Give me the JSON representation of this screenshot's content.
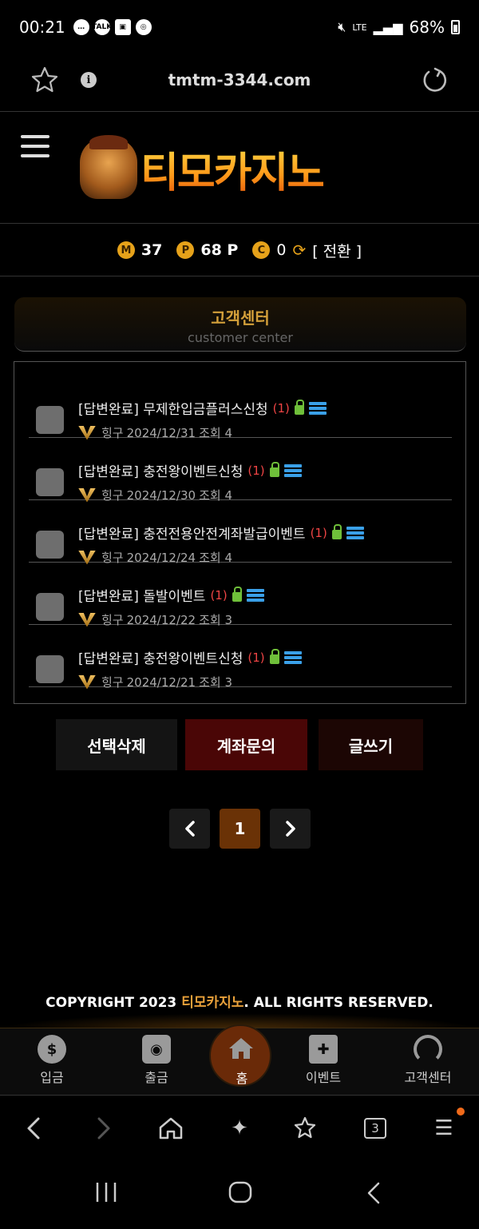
{
  "status_bar": {
    "time": "00:21",
    "battery": "68%",
    "network": "LTE"
  },
  "browser": {
    "url": "tmtm-3344.com"
  },
  "site": {
    "logo_text": "티모카지노"
  },
  "points": {
    "m_label": "M",
    "m_value": "37",
    "p_label": "P",
    "p_value": "68 P",
    "c_label": "C",
    "c_value": "0",
    "switch_label": "[ 전환 ]"
  },
  "section": {
    "title": "고객센터",
    "subtitle": "customer center"
  },
  "posts": [
    {
      "title": "[답변완료] 무제한입금플러스신청",
      "count": "(1)",
      "author": "힝구",
      "date": "2024/12/31",
      "views": "조회 4"
    },
    {
      "title": "[답변완료] 충전왕이벤트신청",
      "count": "(1)",
      "author": "힝구",
      "date": "2024/12/30",
      "views": "조회 4"
    },
    {
      "title": "[답변완료] 충전전용안전계좌발급이벤트",
      "count": "(1)",
      "author": "힝구",
      "date": "2024/12/24",
      "views": "조회 4"
    },
    {
      "title": "[답변완료] 돌발이벤트",
      "count": "(1)",
      "author": "힝구",
      "date": "2024/12/22",
      "views": "조회 3"
    },
    {
      "title": "[답변완료] 충전왕이벤트신청",
      "count": "(1)",
      "author": "힝구",
      "date": "2024/12/21",
      "views": "조회 3"
    }
  ],
  "actions": {
    "delete_label": "선택삭제",
    "account_label": "계좌문의",
    "write_label": "글쓰기"
  },
  "pagination": {
    "prev": "‹",
    "current": "1",
    "next": "›"
  },
  "footer": {
    "copy_prefix": "COPYRIGHT 2023 ",
    "copy_brand": "티모카지노",
    "copy_suffix": ". ALL RIGHTS RESERVED."
  },
  "site_nav": [
    {
      "label": "입금",
      "icon": "dollar-coin-icon"
    },
    {
      "label": "출금",
      "icon": "safe-icon"
    },
    {
      "label": "홈",
      "icon": "home-icon"
    },
    {
      "label": "이벤트",
      "icon": "gift-icon"
    },
    {
      "label": "고객센터",
      "icon": "headset-icon"
    }
  ],
  "browser_toolbar": {
    "tab_count": "3"
  },
  "colors": {
    "accent": "#e8a03a",
    "danger": "#4a0606",
    "page_current": "#6a3206",
    "unread": "#e44444"
  }
}
